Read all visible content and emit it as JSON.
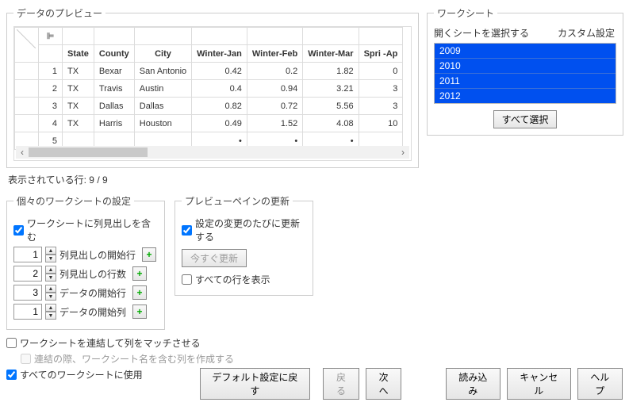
{
  "preview": {
    "legend": "データのプレビュー",
    "headers": [
      "",
      "",
      "State",
      "County",
      "City",
      "Winter-Jan",
      "Winter-Feb",
      "Winter-Mar",
      "Spri -Ap"
    ],
    "rows": [
      {
        "n": "1",
        "state": "TX",
        "county": "Bexar",
        "city": "San Antonio",
        "jan": "0.42",
        "feb": "0.2",
        "mar": "1.82",
        "apr": "0"
      },
      {
        "n": "2",
        "state": "TX",
        "county": "Travis",
        "city": "Austin",
        "jan": "0.4",
        "feb": "0.94",
        "mar": "3.21",
        "apr": "3"
      },
      {
        "n": "3",
        "state": "TX",
        "county": "Dallas",
        "city": "Dallas",
        "jan": "0.82",
        "feb": "0.72",
        "mar": "5.56",
        "apr": "3"
      },
      {
        "n": "4",
        "state": "TX",
        "county": "Harris",
        "city": "Houston",
        "jan": "0.49",
        "feb": "1.52",
        "mar": "4.08",
        "apr": "10"
      },
      {
        "n": "5",
        "state": "",
        "county": "",
        "city": "",
        "jan": "•",
        "feb": "•",
        "mar": "•",
        "apr": ""
      }
    ],
    "rows_shown": "表示されている行: 9 / 9"
  },
  "worksheet": {
    "legend": "ワークシート",
    "select_label": "開くシートを選択する",
    "custom_label": "カスタム設定",
    "items": [
      "2009",
      "2010",
      "2011",
      "2012"
    ],
    "select_all": "すべて選択"
  },
  "indiv": {
    "legend": "個々のワークシートの設定",
    "include_headers": "ワークシートに列見出しを含む",
    "sp": [
      {
        "val": "1",
        "label": "列見出しの開始行"
      },
      {
        "val": "2",
        "label": "列見出しの行数"
      },
      {
        "val": "3",
        "label": "データの開始行"
      },
      {
        "val": "1",
        "label": "データの開始列"
      }
    ]
  },
  "refresh": {
    "legend": "プレビューペインの更新",
    "on_change": "設定の変更のたびに更新する",
    "now": "今すぐ更新",
    "show_all": "すべての行を表示"
  },
  "bottom": {
    "concat": "ワークシートを連結して列をマッチさせる",
    "concat_sub": "連結の際、ワークシート名を含む列を作成する",
    "apply_all": "すべてのワークシートに使用"
  },
  "buttons": {
    "reset": "デフォルト設定に戻す",
    "back": "戻る",
    "next": "次へ",
    "load": "読み込み",
    "cancel": "キャンセル",
    "help": "ヘルプ"
  }
}
